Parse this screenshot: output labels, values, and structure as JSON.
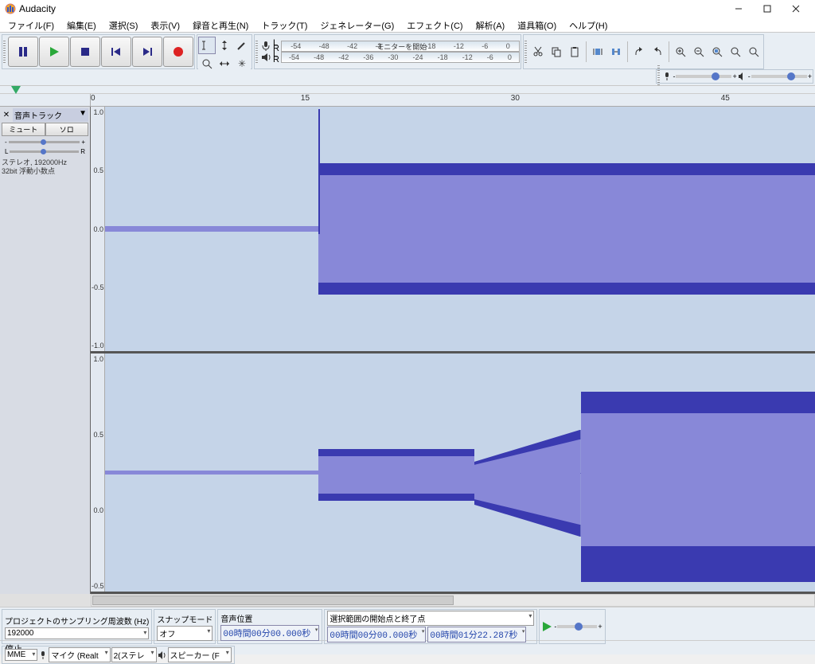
{
  "window": {
    "title": "Audacity"
  },
  "menu": [
    "ファイル(F)",
    "編集(E)",
    "選択(S)",
    "表示(V)",
    "録音と再生(N)",
    "トラック(T)",
    "ジェネレーター(G)",
    "エフェクト(C)",
    "解析(A)",
    "道具箱(O)",
    "ヘルプ(H)"
  ],
  "meters": {
    "rec_ticks": [
      "-54",
      "-48",
      "-42",
      "-3",
      "モニターを開始",
      "14",
      "-18",
      "-12",
      "-6",
      "0"
    ],
    "play_ticks": [
      "-54",
      "-48",
      "-42",
      "-36",
      "-30",
      "-24",
      "-18",
      "-12",
      "-6",
      "0"
    ]
  },
  "timeline": {
    "ticks": [
      {
        "t": "0",
        "p": 0
      },
      {
        "t": "15",
        "p": 29
      },
      {
        "t": "30",
        "p": 58
      },
      {
        "t": "45",
        "p": 87
      }
    ]
  },
  "track": {
    "name": "音声トラック",
    "mute": "ミュート",
    "solo": "ソロ",
    "gain_marks": [
      "-",
      "+"
    ],
    "pan_marks": [
      "L",
      "R"
    ],
    "info1": "ステレオ, 192000Hz",
    "info2": "32bit 浮動小数点",
    "amp_labels": [
      "1.0",
      "0.5",
      "0.0",
      "-0.5",
      "-1.0"
    ]
  },
  "bottom": {
    "sr_label": "プロジェクトのサンプリング周波数 (Hz)",
    "sr_value": "192000",
    "snap_label": "スナップモード",
    "snap_value": "オフ",
    "pos_label": "音声位置",
    "pos_value": "00時間00分00.000秒",
    "sel_label": "選択範囲の開始点と終了点",
    "sel_start": "00時間00分00.000秒",
    "sel_end": "00時間01分22.287秒",
    "host": "MME",
    "rec_dev": "マイク (Realt",
    "rec_ch": "2(ステレ",
    "play_dev": "スピーカー (F"
  },
  "status": "停止。",
  "icons": {
    "pause": "pause",
    "play": "play",
    "stop": "stop",
    "skip_start": "skip-start",
    "skip_end": "skip-end",
    "record": "record"
  }
}
